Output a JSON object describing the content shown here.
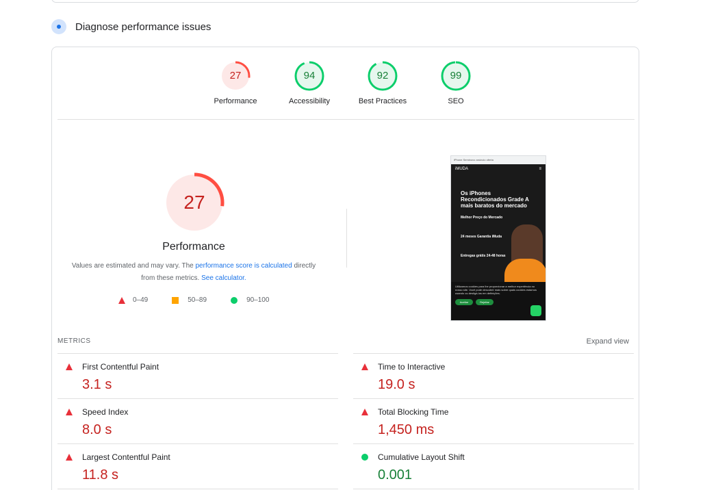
{
  "section": {
    "title": "Diagnose performance issues"
  },
  "gauges": [
    {
      "score": "27",
      "label": "Performance",
      "status": "fail",
      "color": "#ff4e42"
    },
    {
      "score": "94",
      "label": "Accessibility",
      "status": "pass",
      "color": "#0cce6b"
    },
    {
      "score": "92",
      "label": "Best Practices",
      "status": "pass",
      "color": "#0cce6b"
    },
    {
      "score": "99",
      "label": "SEO",
      "status": "pass",
      "color": "#0cce6b"
    }
  ],
  "main_score": {
    "score": "27",
    "title": "Performance",
    "note_prefix": "Values are estimated and may vary. The ",
    "note_link1": "performance score is calculated",
    "note_middle": " directly from these metrics. ",
    "note_link2": "See calculator."
  },
  "legend": [
    {
      "range": "0–49",
      "icon": "red-triangle-icon"
    },
    {
      "range": "50–89",
      "icon": "orange-square-icon"
    },
    {
      "range": "90–100",
      "icon": "green-circle-icon"
    }
  ],
  "screenshot": {
    "topbar": "iPhone Seminovo anúncio oferta",
    "logo": "iMUDA",
    "hero": "Os iPhones Recondicionados Grade A mais baratos do mercado",
    "line1": "Melhor Preço do Mercado",
    "line2": "24 meses Garantia iMuda",
    "line3": "Entregas grátis 24-48 horas",
    "cookie": "Utilizamos cookies para lhe proporcionar a melhor experiência no nosso site. Você pode descobrir mais sobre quais cookies estamos usando ou desligá-los em definições.",
    "accept": "Aceitar",
    "reject": "Rejeitar"
  },
  "metrics": {
    "heading": "METRICS",
    "expand": "Expand view",
    "items": [
      {
        "label": "First Contentful Paint",
        "value": "3.1 s",
        "status": "fail"
      },
      {
        "label": "Time to Interactive",
        "value": "19.0 s",
        "status": "fail"
      },
      {
        "label": "Speed Index",
        "value": "8.0 s",
        "status": "fail"
      },
      {
        "label": "Total Blocking Time",
        "value": "1,450 ms",
        "status": "fail"
      },
      {
        "label": "Largest Contentful Paint",
        "value": "11.8 s",
        "status": "fail"
      },
      {
        "label": "Cumulative Layout Shift",
        "value": "0.001",
        "status": "pass"
      }
    ]
  }
}
